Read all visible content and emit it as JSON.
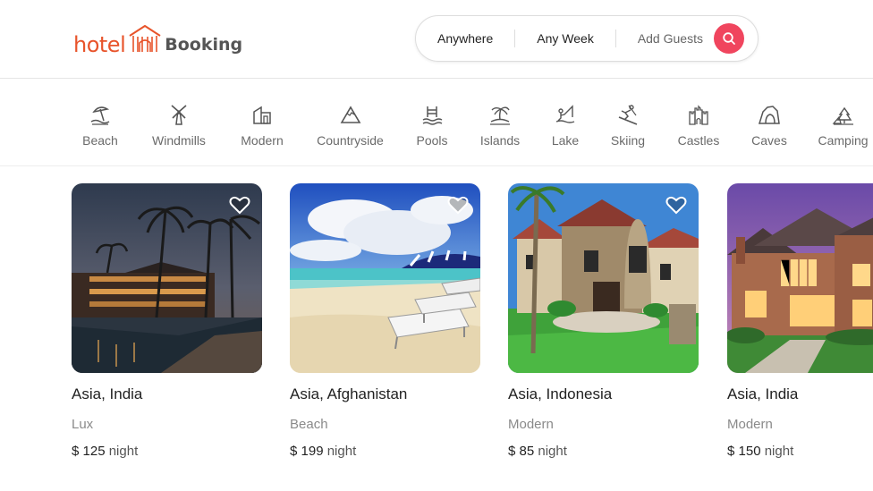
{
  "brand": {
    "part1": "hotel",
    "part2": "Booking",
    "accent": "#e8542b"
  },
  "search": {
    "where": "Anywhere",
    "when": "Any Week",
    "guests": "Add Guests",
    "button_icon": "search-icon",
    "button_color": "#f0455e"
  },
  "categories": [
    {
      "label": "Beach",
      "icon": "beach-umbrella-icon"
    },
    {
      "label": "Windmills",
      "icon": "windmill-icon"
    },
    {
      "label": "Modern",
      "icon": "modern-house-icon"
    },
    {
      "label": "Countryside",
      "icon": "mountain-icon"
    },
    {
      "label": "Pools",
      "icon": "pool-ladder-icon"
    },
    {
      "label": "Islands",
      "icon": "palm-island-icon"
    },
    {
      "label": "Lake",
      "icon": "fishing-lake-icon"
    },
    {
      "label": "Skiing",
      "icon": "skier-icon"
    },
    {
      "label": "Castles",
      "icon": "castle-icon"
    },
    {
      "label": "Caves",
      "icon": "cave-icon"
    },
    {
      "label": "Camping",
      "icon": "camping-tent-icon"
    }
  ],
  "listings": [
    {
      "location": "Asia, India",
      "type": "Lux",
      "currency": "$",
      "price": "125",
      "unit": "night"
    },
    {
      "location": "Asia, Afghanistan",
      "type": "Beach",
      "currency": "$",
      "price": "199",
      "unit": "night"
    },
    {
      "location": "Asia, Indonesia",
      "type": "Modern",
      "currency": "$",
      "price": "85",
      "unit": "night"
    },
    {
      "location": "Asia, India",
      "type": "Modern",
      "currency": "$",
      "price": "150",
      "unit": "night"
    }
  ]
}
